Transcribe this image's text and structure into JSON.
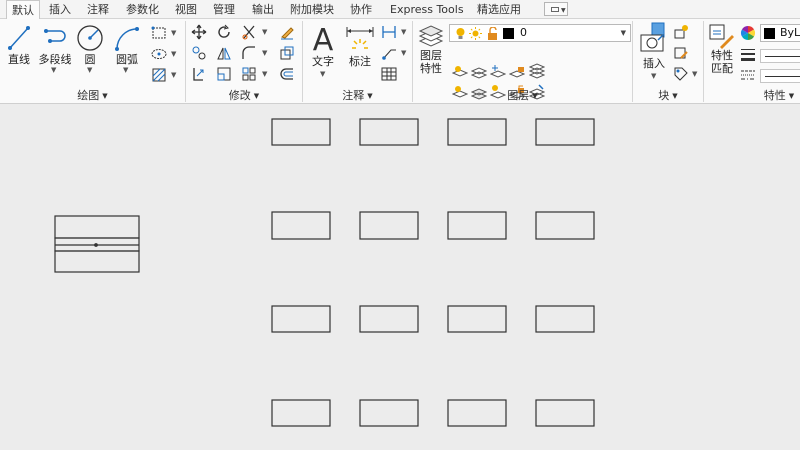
{
  "menu_tabs": [
    "默认",
    "插入",
    "注释",
    "参数化",
    "视图",
    "管理",
    "输出",
    "附加模块",
    "协作",
    "Express Tools",
    "精选应用"
  ],
  "active_tab": "默认",
  "panels": {
    "draw": {
      "title": "绘图",
      "line": "直线",
      "polyline": "多段线",
      "circle": "圆",
      "arc": "圆弧"
    },
    "modify": {
      "title": "修改"
    },
    "annotation": {
      "title": "注释",
      "text": "文字",
      "dimension": "标注"
    },
    "layers": {
      "title": "图层",
      "layer_properties_line1": "图层",
      "layer_properties_line2": "特性",
      "current_layer": "0"
    },
    "block": {
      "title": "块",
      "insert": "插入"
    },
    "properties": {
      "title": "特性",
      "match_line1": "特性",
      "match_line2": "匹配",
      "color_value": "ByLa"
    }
  },
  "colors": {
    "accent_blue": "#1f6fbf",
    "bulb_yellow": "#f0b400",
    "lock_orange": "#e08a1e",
    "canvas_bg": "#ececec"
  },
  "icons": {
    "layer_state_icons": [
      "lightbulb-on-icon",
      "sun-icon",
      "unlock-icon",
      "color-swatch-icon"
    ]
  }
}
